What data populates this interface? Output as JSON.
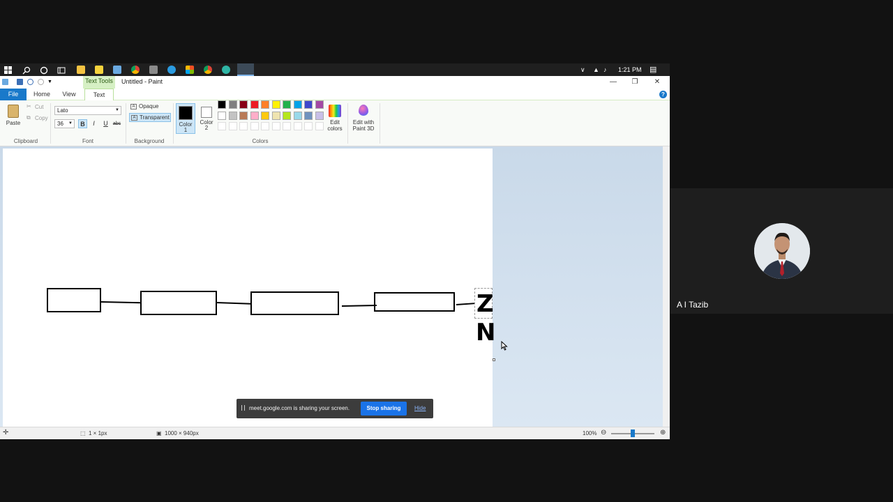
{
  "taskbar": {
    "time": "1:21 PM",
    "icons": [
      "start-icon",
      "search-icon",
      "cortana-icon",
      "task-view-icon",
      "file-explorer-icon",
      "sticky-icon",
      "notepad-icon",
      "chrome-icon",
      "calculator-icon",
      "edge-icon",
      "office-icon",
      "chrome-icon-2",
      "edge-icon-2",
      "paint-icon"
    ]
  },
  "window": {
    "context_tab": "Text Tools",
    "title": "Untitled - Paint",
    "tabs": {
      "file": "File",
      "home": "Home",
      "view": "View",
      "text": "Text"
    }
  },
  "ribbon": {
    "clipboard": {
      "paste": "Paste",
      "cut": "Cut",
      "copy": "Copy",
      "label": "Clipboard"
    },
    "font": {
      "family": "Lato",
      "size": "36",
      "bold": "B",
      "italic": "I",
      "underline": "U",
      "strike": "abc",
      "label": "Font"
    },
    "background": {
      "opaque": "Opaque",
      "transparent": "Transparent",
      "label": "Background"
    },
    "colors": {
      "color1_line1": "Color",
      "color1_line2": "1",
      "color2_line1": "Color",
      "color2_line2": "2",
      "label": "Colors",
      "edit_line1": "Edit",
      "edit_line2": "colors",
      "paint3d_line1": "Edit with",
      "paint3d_line2": "Paint 3D",
      "color1": "#000000",
      "color2": "#ffffff",
      "row1": [
        "#000000",
        "#7f7f7f",
        "#880015",
        "#ed1c24",
        "#ff7f27",
        "#fff200",
        "#22b14c",
        "#00a2e8",
        "#3f48cc",
        "#a349a4"
      ],
      "row2": [
        "#ffffff",
        "#c3c3c3",
        "#b97a57",
        "#ffaec9",
        "#ffc90e",
        "#efe4b0",
        "#b5e61d",
        "#99d9ea",
        "#7092be",
        "#c8bfe7"
      ],
      "row3": [
        "#ffffff",
        "#ffffff",
        "#ffffff",
        "#ffffff",
        "#ffffff",
        "#ffffff",
        "#ffffff",
        "#ffffff",
        "#ffffff",
        "#ffffff"
      ]
    }
  },
  "canvas": {
    "letters": [
      "Z",
      "N"
    ]
  },
  "status": {
    "selection_size": "1 × 1px",
    "image_size": "1000 × 940px",
    "zoom": "100%"
  },
  "toast": {
    "message": "meet.google.com is sharing your screen.",
    "stop": "Stop sharing",
    "hide": "Hide"
  },
  "participant": {
    "name": "A I Tazib"
  }
}
